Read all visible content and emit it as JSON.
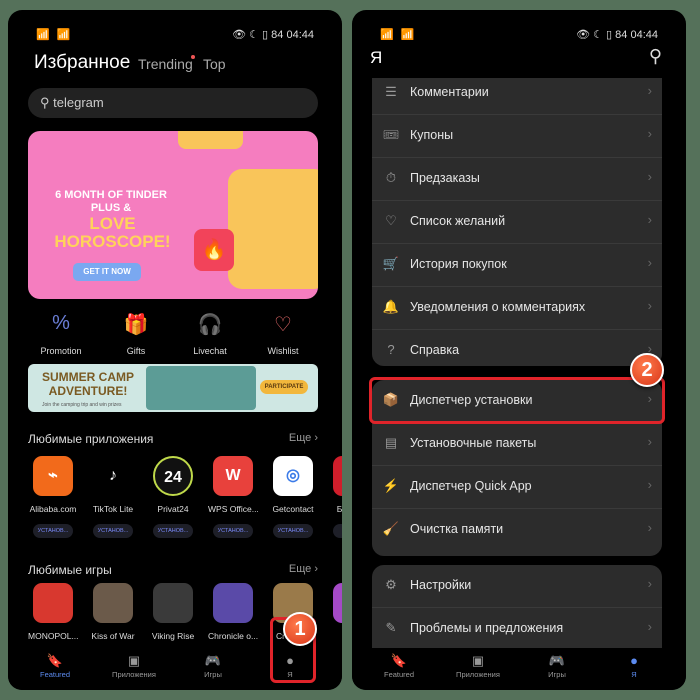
{
  "status": {
    "time": "04:44",
    "signal": "📶 📶",
    "icons": "👁 ☾ ▯ 84"
  },
  "left": {
    "title": "Избранное",
    "tabs": [
      "Trending",
      "Top"
    ],
    "search": {
      "value": "telegram",
      "icon": "search-icon"
    },
    "banner": {
      "line1": "6 MONTH OF TINDER PLUS &",
      "line2": "LOVE HOROSCOPE!",
      "button": "GET IT NOW"
    },
    "quick": [
      {
        "label": "Promotion",
        "icon": "percent-badge-icon",
        "color": "#6b7fd8"
      },
      {
        "label": "Gifts",
        "icon": "gift-icon",
        "color": "#e8674a"
      },
      {
        "label": "Livechat",
        "icon": "headset-icon",
        "color": "#5b8fd8"
      },
      {
        "label": "Wishlist",
        "icon": "bookmark-heart-icon",
        "color": "#e86b6b"
      }
    ],
    "camp": {
      "title": "SUMMER CAMP ADVENTURE!",
      "sub": "Join the camping trip and win prizes",
      "button": "PARTICIPATE"
    },
    "apps_title": "Любимые приложения",
    "more": "Еще",
    "apps": [
      {
        "name": "Alibaba.com",
        "btn": "УСТАНОВ..."
      },
      {
        "name": "TikTok Lite",
        "btn": "УСТАНОВ..."
      },
      {
        "name": "Privat24",
        "btn": "УСТАНОВ..."
      },
      {
        "name": "WPS Office...",
        "btn": "УСТАНОВ..."
      },
      {
        "name": "Getcontact",
        "btn": "УСТАНОВ..."
      },
      {
        "name": "Браузер",
        "btn": "УСТАН"
      }
    ],
    "games_title": "Любимые игры",
    "games": [
      "MONOPOL...",
      "Kiss of War",
      "Viking Rise",
      "Chronicle o...",
      "Crossout",
      ""
    ],
    "nav": [
      "Featured",
      "Приложения",
      "Игры",
      "Я"
    ]
  },
  "right": {
    "title": "Я",
    "group1": [
      "Комментарии",
      "Купоны",
      "Предзаказы",
      "Список желаний",
      "История покупок",
      "Уведомления о комментариях",
      "Справка"
    ],
    "group2": [
      "Диспетчер установки",
      "Установочные пакеты",
      "Диспетчер Quick App",
      "Очистка памяти"
    ],
    "group3": [
      "Настройки",
      "Проблемы и предложения"
    ],
    "nav": [
      "Featured",
      "Приложения",
      "Игры",
      "Я"
    ]
  },
  "badges": [
    "1",
    "2"
  ],
  "colors": {
    "accent": "#5c8bf0",
    "highlight": "#e0242a",
    "badge": "#e84a25"
  }
}
